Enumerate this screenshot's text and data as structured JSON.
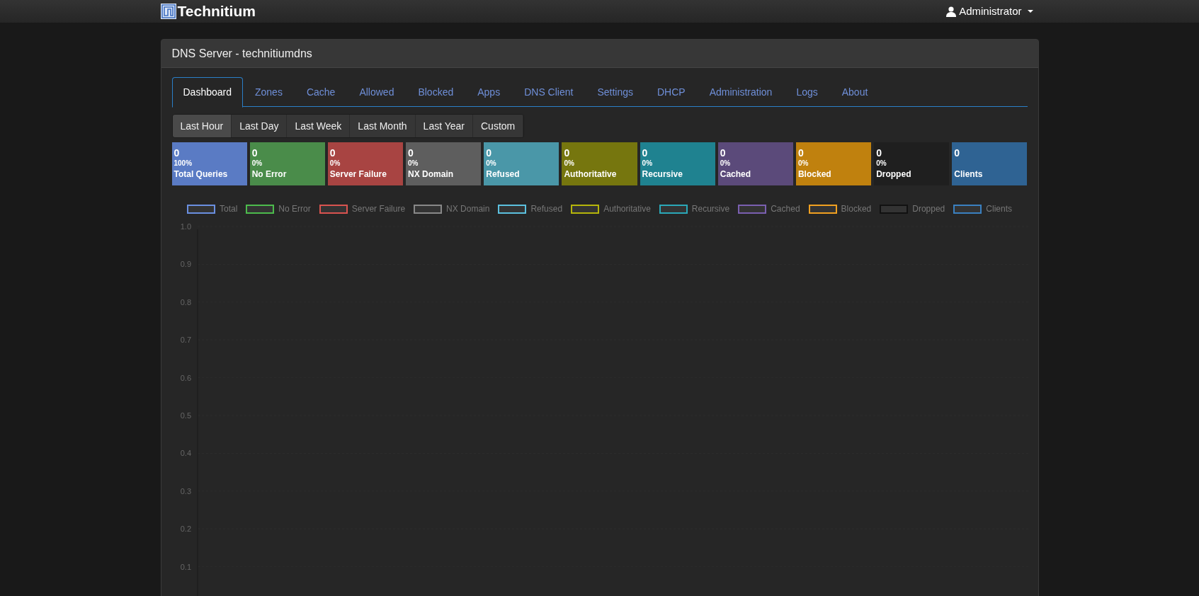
{
  "navbar": {
    "brand": "Technitium",
    "user": "Administrator"
  },
  "panel": {
    "title": "DNS Server - technitiumdns"
  },
  "tabs": [
    {
      "label": "Dashboard",
      "selected": true
    },
    {
      "label": "Zones",
      "selected": false
    },
    {
      "label": "Cache",
      "selected": false
    },
    {
      "label": "Allowed",
      "selected": false
    },
    {
      "label": "Blocked",
      "selected": false
    },
    {
      "label": "Apps",
      "selected": false
    },
    {
      "label": "DNS Client",
      "selected": false
    },
    {
      "label": "Settings",
      "selected": false
    },
    {
      "label": "DHCP",
      "selected": false
    },
    {
      "label": "Administration",
      "selected": false
    },
    {
      "label": "Logs",
      "selected": false
    },
    {
      "label": "About",
      "selected": false
    }
  ],
  "time_ranges": [
    {
      "label": "Last Hour",
      "selected": true
    },
    {
      "label": "Last Day",
      "selected": false
    },
    {
      "label": "Last Week",
      "selected": false
    },
    {
      "label": "Last Month",
      "selected": false
    },
    {
      "label": "Last Year",
      "selected": false
    },
    {
      "label": "Custom",
      "selected": false
    }
  ],
  "stats": [
    {
      "value": "0",
      "percent": "100%",
      "label": "Total Queries",
      "color": "#5a7bc4"
    },
    {
      "value": "0",
      "percent": "0%",
      "label": "No Error",
      "color": "#4a8c4a"
    },
    {
      "value": "0",
      "percent": "0%",
      "label": "Server Failure",
      "color": "#a84442"
    },
    {
      "value": "0",
      "percent": "0%",
      "label": "NX Domain",
      "color": "#5e5e5e"
    },
    {
      "value": "0",
      "percent": "0%",
      "label": "Refused",
      "color": "#4a97a8"
    },
    {
      "value": "0",
      "percent": "0%",
      "label": "Authoritative",
      "color": "#76760e"
    },
    {
      "value": "0",
      "percent": "0%",
      "label": "Recursive",
      "color": "#1f8290"
    },
    {
      "value": "0",
      "percent": "0%",
      "label": "Cached",
      "color": "#5b4a7a"
    },
    {
      "value": "0",
      "percent": "0%",
      "label": "Blocked",
      "color": "#c0810e"
    },
    {
      "value": "0",
      "percent": "0%",
      "label": "Dropped",
      "color": "#1f1f1f"
    },
    {
      "value": "0",
      "label": "Clients",
      "color": "#2f6393"
    }
  ],
  "chart_data": {
    "type": "line",
    "ylim": [
      0,
      1
    ],
    "yticks": [
      0.1,
      0.2,
      0.3,
      0.4,
      0.5,
      0.6,
      0.7,
      0.8,
      0.9,
      {
        "value": 1,
        "label": "1.0"
      }
    ],
    "series": [
      {
        "name": "Total",
        "color": "#6a8fe0"
      },
      {
        "name": "No Error",
        "color": "#4cbb4c"
      },
      {
        "name": "Server Failure",
        "color": "#d9534f"
      },
      {
        "name": "NX Domain",
        "color": "#888888"
      },
      {
        "name": "Refused",
        "color": "#5bc0de"
      },
      {
        "name": "Authoritative",
        "color": "#b5b50a"
      },
      {
        "name": "Recursive",
        "color": "#2aa8b8"
      },
      {
        "name": "Cached",
        "color": "#7a5fb0"
      },
      {
        "name": "Blocked",
        "color": "#f0a020"
      },
      {
        "name": "Dropped",
        "color": "#111111"
      },
      {
        "name": "Clients",
        "color": "#3a80c0"
      }
    ]
  }
}
